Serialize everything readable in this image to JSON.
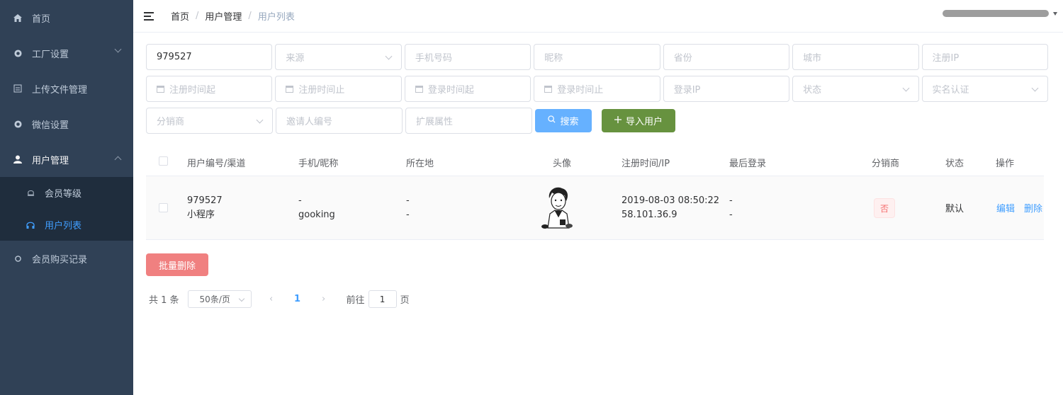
{
  "sidebar": {
    "items": [
      {
        "label": "首页"
      },
      {
        "label": "工厂设置"
      },
      {
        "label": "上传文件管理"
      },
      {
        "label": "微信设置"
      },
      {
        "label": "用户管理"
      },
      {
        "label": "会员购买记录"
      }
    ],
    "submenu": [
      {
        "label": "会员等级"
      },
      {
        "label": "用户列表"
      }
    ]
  },
  "breadcrumb": [
    "首页",
    "用户管理",
    "用户列表"
  ],
  "filters": {
    "user_id": "979527",
    "source": "来源",
    "phone": "手机号码",
    "nickname": "昵称",
    "province": "省份",
    "city": "城市",
    "reg_ip": "注册IP",
    "reg_time_from": "注册时间起",
    "reg_time_to": "注册时间止",
    "login_time_from": "登录时间起",
    "login_time_to": "登录时间止",
    "login_ip": "登录IP",
    "status": "状态",
    "realname": "实名认证",
    "distributor": "分销商",
    "inviter": "邀请人编号",
    "ext_attr": "扩展属性",
    "search_label": "搜索",
    "import_label": "导入用户"
  },
  "table": {
    "headers": [
      "用户编号/渠道",
      "手机/昵称",
      "所在地",
      "头像",
      "注册时间/IP",
      "最后登录",
      "分销商",
      "状态",
      "操作"
    ],
    "rows": [
      {
        "id": "979527",
        "channel": "小程序",
        "phone": "-",
        "nickname": "gooking",
        "loc1": "-",
        "loc2": "-",
        "reg_time": "2019-08-03 08:50:22",
        "reg_ip": "58.101.36.9",
        "last1": "-",
        "last2": "-",
        "distributor": "否",
        "status": "默认",
        "edit": "编辑",
        "delete": "删除"
      }
    ]
  },
  "batch_delete": "批量删除",
  "pagination": {
    "total": "共 1 条",
    "page_size": "50条/页",
    "current": "1",
    "goto": "前往",
    "goto_value": "1",
    "page_unit": "页"
  }
}
